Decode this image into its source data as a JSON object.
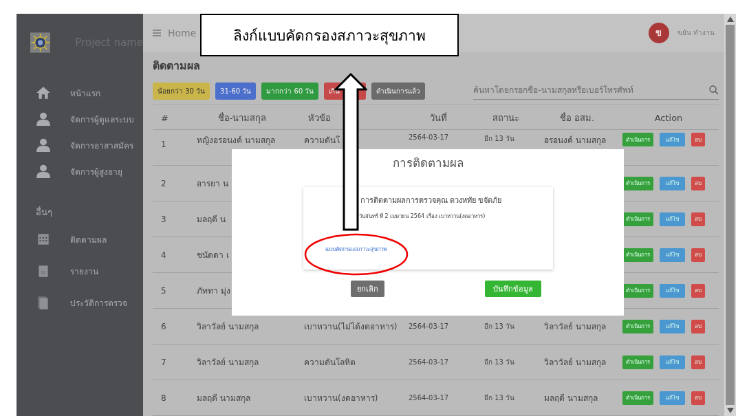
{
  "sidebar": {
    "project_name": "Project name",
    "menu": [
      {
        "label": "หน้าแรก",
        "kind": "home"
      },
      {
        "label": "จัดการผู้ดูแลระบบ",
        "kind": "person"
      },
      {
        "label": "จัดการอาสาสมัคร",
        "kind": "person"
      },
      {
        "label": "จัดการผู้สูงอายุ",
        "kind": "person"
      }
    ],
    "section_title": "อื่นๆ",
    "other": [
      {
        "label": "ติดตามผล",
        "kind": "calendar"
      },
      {
        "label": "รายงาน",
        "kind": "document"
      },
      {
        "label": "ประวัติการตรวจ",
        "kind": "pages"
      }
    ]
  },
  "header": {
    "home": "Home",
    "user": {
      "initial": "ข",
      "name": "ขยัน ทำงาน"
    }
  },
  "page_title": "ติดตามผล",
  "filters": [
    {
      "label": "น้อยกว่า 30 วัน",
      "color": "#c9b54a"
    },
    {
      "label": "31-60 วัน",
      "color": "#4c6fcc"
    },
    {
      "label": "มากกว่า 60 วัน",
      "color": "#2f9a3f"
    },
    {
      "label": "เกิน",
      "color": "#c64a4a"
    },
    {
      "label": "ดำเนินการแล้ว",
      "color": "#6b6b6b"
    }
  ],
  "search": {
    "placeholder": "ค้นหาโดยกรอกชื่อ-นามสกุลหรือเบอร์โทรศัพท์"
  },
  "table": {
    "columns": [
      "#",
      "ชื่อ-นามสกุล",
      "หัวข้อ",
      "วันที่",
      "สถานะ",
      "ชื่อ อสม.",
      "Action"
    ],
    "rows": [
      {
        "cells": [
          "1",
          "หญิงอรอนงค์ นามสกุล",
          "ความดันโ",
          "2564-03-17",
          "อีก 13 วัน",
          "อรอนงค์ นามสกุล"
        ],
        "actions": [
          "ดำเนินการ",
          "แก้ไข",
          "ลบ"
        ]
      },
      {
        "cells": [
          "2",
          "อารยา น"
        ],
        "actions": [
          "ดำเนินการ",
          "แก้ไข",
          "ลบ"
        ]
      },
      {
        "cells": [
          "3",
          "มลฤดี น"
        ],
        "actions": [
          "ดำเนินการ",
          "แก้ไข",
          "ลบ"
        ]
      },
      {
        "cells": [
          "4",
          "ชนัดดา เ"
        ],
        "actions": [
          "ดำเนินการ",
          "แก้ไข",
          "ลบ"
        ]
      },
      {
        "cells": [
          "5",
          "ภัททา มุ่ง"
        ],
        "actions": [
          "ดำเนินการ",
          "แก้ไข",
          "ลบ"
        ]
      },
      {
        "cells": [
          "6",
          "วิลาวัลย์ นามสกุล",
          "เบาหวาน(ไม่ได้งดอาหาร)",
          "2564-03-17",
          "อีก 13 วัน",
          "วิลาวัลย์ นามสกุล"
        ],
        "actions": [
          "ดำเนินการ",
          "แก้ไข",
          "ลบ"
        ]
      },
      {
        "cells": [
          "7",
          "วิลาวัลย์ นามสกุล",
          "ความดันโลหิต",
          "2564-03-17",
          "อีก 13 วัน",
          "วิลาวัลย์ นามสกุล"
        ],
        "actions": [
          "ดำเนินการ",
          "แก้ไข",
          "ลบ"
        ]
      },
      {
        "cells": [
          "8",
          "มลฤดี นามสกุล",
          "เบาหวาน(งดอาหาร)",
          "2564-03-17",
          "อีก 13 วัน",
          "มลฤดี นามสกุล"
        ],
        "actions": [
          "ดำเนินการ",
          "แก้ไข",
          "ลบ"
        ]
      }
    ]
  },
  "dialog": {
    "title": "การติดตามผล",
    "heading": "การติดตามผลการตรวจคุณ ดวงหทัย ขจัดภัย",
    "detail": "วันจันทร์ ที่ 2 เมษายน 2564 เรื่อง เบาหวาน(งดอาหาร)",
    "link": "แบบคัดกรองสภาวะสุขภาพ",
    "buttons": [
      {
        "label": "ยกเลิก",
        "kind": "cancel"
      },
      {
        "label": "บันทึกข้อมูล",
        "kind": "save"
      }
    ]
  },
  "annotation": {
    "callout": "ลิงก์แบบคัดกรองสภาวะสุขภาพ"
  }
}
